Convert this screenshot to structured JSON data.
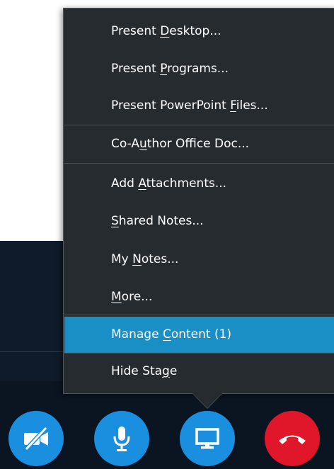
{
  "menu": {
    "items": [
      {
        "pre": "Present ",
        "key": "D",
        "post": "esktop..."
      },
      {
        "pre": "Present ",
        "key": "P",
        "post": "rograms..."
      },
      {
        "pre": "Present PowerPoint ",
        "key": "F",
        "post": "iles..."
      },
      {
        "pre": "Co-A",
        "key": "u",
        "post": "thor Office Doc..."
      },
      {
        "pre": "Add ",
        "key": "A",
        "post": "ttachments..."
      },
      {
        "pre": "",
        "key": "S",
        "post": "hared Notes..."
      },
      {
        "pre": "My ",
        "key": "N",
        "post": "otes..."
      },
      {
        "pre": "",
        "key": "M",
        "post": "ore..."
      },
      {
        "pre": "Manage ",
        "key": "C",
        "post": "ontent (1)"
      },
      {
        "pre": "Hide Sta",
        "key": "g",
        "post": "e"
      }
    ],
    "active_index": 8
  },
  "call_controls": [
    {
      "icon": "video-off-icon",
      "state": "off"
    },
    {
      "icon": "microphone-icon",
      "state": "on"
    },
    {
      "icon": "monitor-icon",
      "state": "active"
    },
    {
      "icon": "hang-up-icon",
      "state": "end-call"
    }
  ],
  "colors": {
    "menu_bg": "#262b30",
    "highlight": "#1a8fc6",
    "button_blue": "#1a8fe0",
    "button_red": "#e0162b",
    "stage_bg": "#0f1b2a"
  }
}
